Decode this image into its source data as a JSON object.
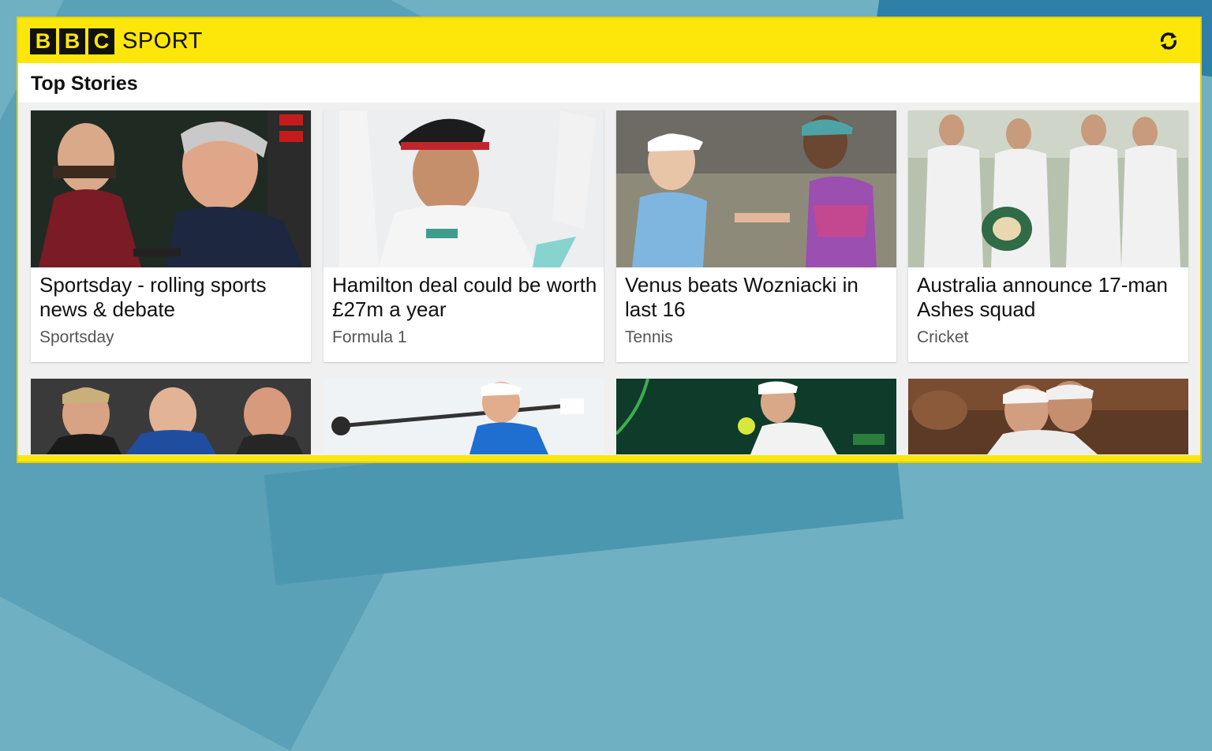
{
  "app": {
    "logo_letters": [
      "B",
      "B",
      "C"
    ],
    "logo_word": "SPORT",
    "refresh_icon": "refresh-icon"
  },
  "section": {
    "title": "Top Stories"
  },
  "stories": [
    {
      "headline": "Sportsday - rolling sports news & debate",
      "category": "Sportsday"
    },
    {
      "headline": "Hamilton deal could be worth £27m a year",
      "category": "Formula 1"
    },
    {
      "headline": "Venus beats Wozniacki in last 16",
      "category": "Tennis"
    },
    {
      "headline": "Australia announce 17-man Ashes squad",
      "category": "Cricket"
    }
  ],
  "colors": {
    "brand_yellow": "#fde60a",
    "logo_black": "#111111",
    "background": "#6fb0c2"
  }
}
